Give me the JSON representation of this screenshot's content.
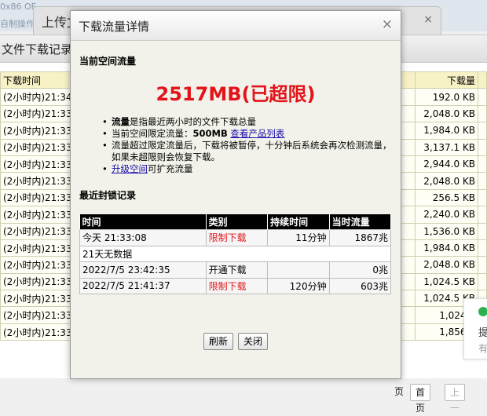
{
  "background": {
    "top_line1": "0x86 OF",
    "top_line2": "自制操作",
    "upload_tab_title": "上传文",
    "upload_close": "×",
    "window_title": "文件下载记录",
    "table": {
      "headers": [
        "下载时间",
        "下载量"
      ],
      "rows": [
        {
          "time": "(2小时内)21:34:",
          "size": "192.0 KB"
        },
        {
          "time": "(2小时内)21:33:",
          "size": "2,048.0 KB"
        },
        {
          "time": "(2小时内)21:33:",
          "size": "1,984.0 KB"
        },
        {
          "time": "(2小时内)21:33:",
          "size": "3,137.1 KB"
        },
        {
          "time": "(2小时内)21:33:",
          "size": "2,944.0 KB"
        },
        {
          "time": "(2小时内)21:33:",
          "size": "2,048.0 KB"
        },
        {
          "time": "(2小时内)21:33:",
          "size": "256.5 KB"
        },
        {
          "time": "(2小时内)21:33:",
          "size": "2,240.0 KB"
        },
        {
          "time": "(2小时内)21:33:",
          "size": "1,536.0 KB"
        },
        {
          "time": "(2小时内)21:33:",
          "size": "1,984.0 KB"
        },
        {
          "time": "(2小时内)21:33:",
          "size": "2,048.0 KB"
        },
        {
          "time": "(2小时内)21:33:",
          "size": "1,024.5 KB"
        },
        {
          "time": "(2小时内)21:33:",
          "size": "1,024.5 KB"
        },
        {
          "time": "(2小时内)21:33:",
          "size": "1,024.5"
        },
        {
          "time": "(2小时内)21:33:",
          "size": "1,856.0"
        }
      ]
    },
    "pager": {
      "prefix": "页",
      "first": "首页",
      "prev": "上一"
    },
    "float_card": {
      "line1": "提",
      "line2": "有"
    }
  },
  "dialog": {
    "title": "下载流量详情",
    "close": "×",
    "current_section": "当前空间流量",
    "usage": "2517MB(已超限)",
    "notes": {
      "n1_bold": "流量",
      "n1_text": "是指最近两小时的文件下载总量",
      "n2_text": "当前空间限定流量：",
      "n2_bold": "500MB",
      "n2_link": "查看产品列表",
      "n3_text": "流量超过限定流量后，下载将被暂停，十分钟后系统会再次检测流量，如果未超限则会恢复下载。",
      "n4_link": "升级空间",
      "n4_text": "可扩充流量"
    },
    "records_section": "最近封锁记录",
    "records": {
      "headers": [
        "时间",
        "类别",
        "持续时间",
        "当时流量"
      ],
      "row1": {
        "time": "今天 21:33:08",
        "type": "限制下载",
        "duration": "11分钟",
        "traffic": "1867兆"
      },
      "no_data": "21天无数据",
      "row2": {
        "time": "2022/7/5 23:42:35",
        "type": "开通下载",
        "duration": "",
        "traffic": "0兆"
      },
      "row3": {
        "time": "2022/7/5 21:41:37",
        "type": "限制下载",
        "duration": "120分钟",
        "traffic": "603兆"
      }
    },
    "refresh_button": "刷新",
    "close_button": "关闭"
  },
  "colors": {
    "accent_red": "#e2141a",
    "link": "#1a0dab",
    "header_black": "#000000"
  }
}
